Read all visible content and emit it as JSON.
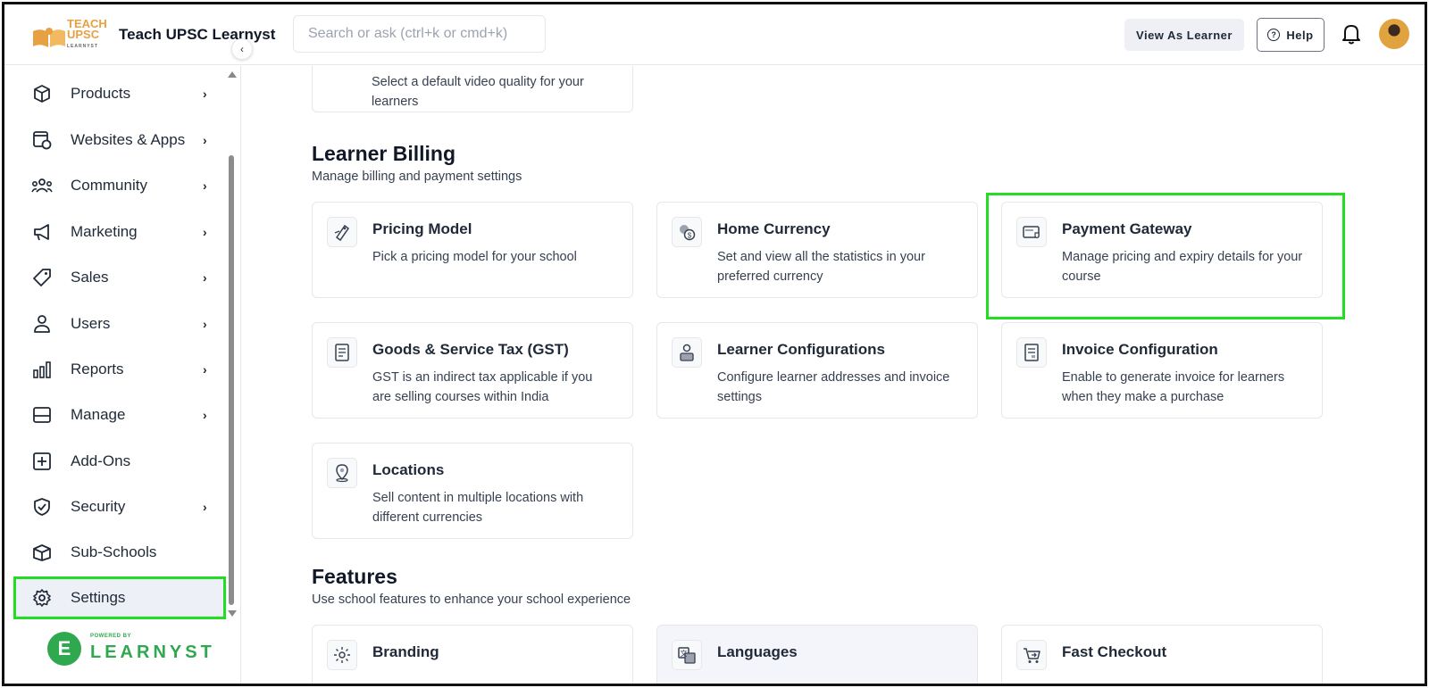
{
  "header": {
    "logo_text_top": "TEACH",
    "logo_text_bottom": "UPSC",
    "logo_text_small": "LEARNYST",
    "school_name": "Teach UPSC Learnyst",
    "search_placeholder": "Search or ask (ctrl+k or cmd+k)",
    "view_as_learner": "View As Learner",
    "help": "Help"
  },
  "sidebar": {
    "items": [
      {
        "label": "Products",
        "icon": "cube-icon",
        "chevron": "›"
      },
      {
        "label": "Websites & Apps",
        "icon": "website-icon",
        "chevron": "›"
      },
      {
        "label": "Community",
        "icon": "community-icon",
        "chevron": "›"
      },
      {
        "label": "Marketing",
        "icon": "megaphone-icon",
        "chevron": "›"
      },
      {
        "label": "Sales",
        "icon": "tag-icon",
        "chevron": "›"
      },
      {
        "label": "Users",
        "icon": "user-icon",
        "chevron": "›"
      },
      {
        "label": "Reports",
        "icon": "bar-chart-icon",
        "chevron": "›"
      },
      {
        "label": "Manage",
        "icon": "manage-icon",
        "chevron": "›"
      },
      {
        "label": "Add-Ons",
        "icon": "plus-square-icon",
        "chevron": ""
      },
      {
        "label": "Security",
        "icon": "shield-icon",
        "chevron": "›"
      },
      {
        "label": "Sub-Schools",
        "icon": "box-icon",
        "chevron": ""
      },
      {
        "label": "Settings",
        "icon": "gear-icon",
        "chevron": ""
      }
    ],
    "active": "Settings",
    "collapse_glyph": "‹",
    "powered_small": "POWERED BY",
    "powered_brand": "LEARNYST",
    "powered_logo_letter": "E"
  },
  "main": {
    "partial_card": {
      "desc": "Select a default video quality for your learners"
    },
    "learner_billing": {
      "title": "Learner Billing",
      "subtitle": "Manage billing and payment settings",
      "cards": [
        {
          "title": "Pricing Model",
          "desc": "Pick a pricing model for your school",
          "icon": "pricing-icon"
        },
        {
          "title": "Home Currency",
          "desc": "Set and view all the statistics in your preferred currency",
          "icon": "currency-icon"
        },
        {
          "title": "Payment Gateway",
          "desc": "Manage pricing and expiry details for your course",
          "icon": "payment-card-icon"
        },
        {
          "title": "Goods & Service Tax (GST)",
          "desc": "GST is an indirect tax applicable if you are selling courses within India",
          "icon": "tax-document-icon"
        },
        {
          "title": "Learner Configurations",
          "desc": "Configure learner addresses and invoice settings",
          "icon": "learner-config-icon"
        },
        {
          "title": "Invoice Configuration",
          "desc": "Enable to generate invoice for learners when they make a purchase",
          "icon": "invoice-icon"
        },
        {
          "title": "Locations",
          "desc": "Sell content in multiple locations with different currencies",
          "icon": "location-pin-icon"
        }
      ]
    },
    "features": {
      "title": "Features",
      "subtitle": "Use school features to enhance your school experience",
      "cards": [
        {
          "title": "Branding",
          "icon": "branding-icon"
        },
        {
          "title": "Languages",
          "icon": "languages-icon"
        },
        {
          "title": "Fast Checkout",
          "icon": "cart-icon"
        }
      ]
    }
  },
  "colors": {
    "highlight": "#22dd22",
    "brand_green": "#2fa84f",
    "logo_orange": "#e7a142"
  }
}
